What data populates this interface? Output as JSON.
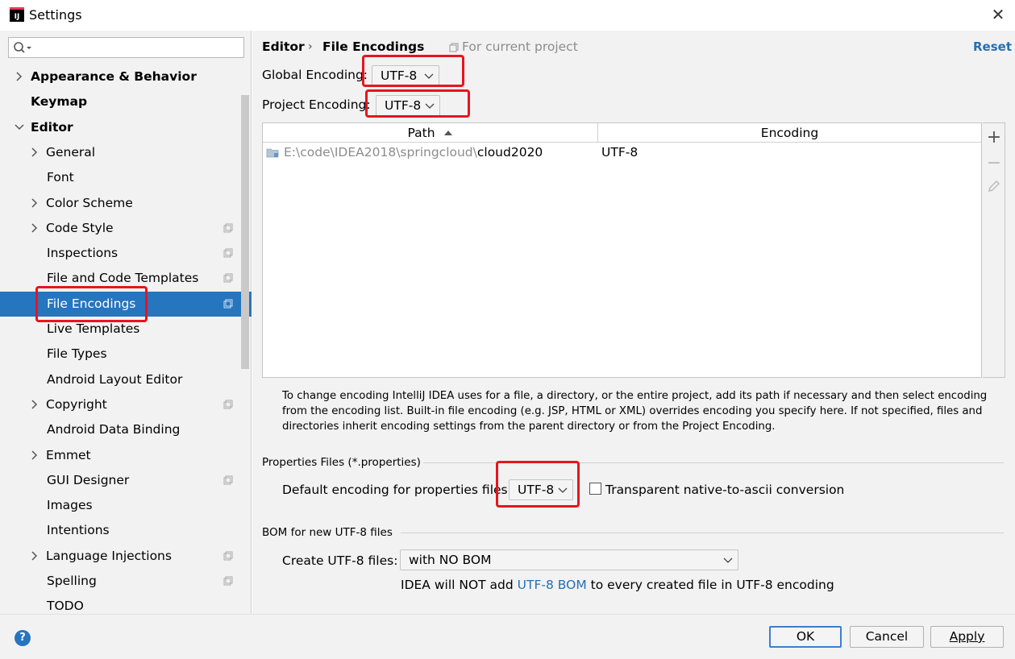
{
  "window": {
    "title": "Settings"
  },
  "search": {
    "placeholder": ""
  },
  "sidebar": {
    "items": [
      {
        "label": "Appearance & Behavior",
        "bold": true,
        "level": 0,
        "chevron": "right"
      },
      {
        "label": "Keymap",
        "bold": true,
        "level": 0,
        "chevron": ""
      },
      {
        "label": "Editor",
        "bold": true,
        "level": 0,
        "chevron": "down"
      },
      {
        "label": "General",
        "level": 1,
        "chevron": "right"
      },
      {
        "label": "Font",
        "level": 1,
        "chevron": ""
      },
      {
        "label": "Color Scheme",
        "level": 1,
        "chevron": "right"
      },
      {
        "label": "Code Style",
        "level": 1,
        "chevron": "right",
        "scope_icon": true
      },
      {
        "label": "Inspections",
        "level": 1,
        "chevron": "",
        "scope_icon": true
      },
      {
        "label": "File and Code Templates",
        "level": 1,
        "chevron": "",
        "scope_icon": true
      },
      {
        "label": "File Encodings",
        "level": 1,
        "chevron": "",
        "scope_icon": true,
        "selected": true
      },
      {
        "label": "Live Templates",
        "level": 1,
        "chevron": ""
      },
      {
        "label": "File Types",
        "level": 1,
        "chevron": ""
      },
      {
        "label": "Android Layout Editor",
        "level": 1,
        "chevron": ""
      },
      {
        "label": "Copyright",
        "level": 1,
        "chevron": "right",
        "scope_icon": true
      },
      {
        "label": "Android Data Binding",
        "level": 1,
        "chevron": ""
      },
      {
        "label": "Emmet",
        "level": 1,
        "chevron": "right"
      },
      {
        "label": "GUI Designer",
        "level": 1,
        "chevron": "",
        "scope_icon": true
      },
      {
        "label": "Images",
        "level": 1,
        "chevron": ""
      },
      {
        "label": "Intentions",
        "level": 1,
        "chevron": ""
      },
      {
        "label": "Language Injections",
        "level": 1,
        "chevron": "right",
        "scope_icon": true
      },
      {
        "label": "Spelling",
        "level": 1,
        "chevron": "",
        "scope_icon": true
      },
      {
        "label": "TODO",
        "level": 1,
        "chevron": ""
      }
    ]
  },
  "header": {
    "crumb_parent": "Editor",
    "crumb_current": "File Encodings",
    "scope_note": "For current project",
    "reset_label": "Reset"
  },
  "encoding": {
    "global_label": "Global Encoding:",
    "global_value": "UTF-8",
    "project_label": "Project Encoding:",
    "project_value": "UTF-8"
  },
  "table": {
    "columns": [
      "Path",
      "Encoding"
    ],
    "rows": [
      {
        "path_prefix": "E:\\code\\IDEA2018\\springcloud\\",
        "path_name": "cloud2020",
        "encoding": "UTF-8"
      }
    ]
  },
  "tools": {
    "add": "+",
    "remove": "−"
  },
  "info_text": "To change encoding IntelliJ IDEA uses for a file, a directory, or the entire project, add its path if necessary and then select encoding from the encoding list. Built-in file encoding (e.g. JSP, HTML or XML) overrides encoding you specify here. If not specified, files and directories inherit encoding settings from the parent directory or from the Project Encoding.",
  "properties": {
    "section_title": "Properties Files (*.properties)",
    "default_label": "Default encoding for properties files",
    "default_value": "UTF-8",
    "transparent_label": "Transparent native-to-ascii conversion",
    "transparent_checked": false
  },
  "bom": {
    "section_title": "BOM for new UTF-8 files",
    "create_label": "Create UTF-8 files:",
    "create_value": "with NO BOM",
    "note_before": "IDEA will NOT add ",
    "note_link": "UTF-8 BOM",
    "note_after": " to every created file in UTF-8 encoding"
  },
  "footer": {
    "help": "?",
    "ok": "OK",
    "cancel": "Cancel",
    "apply": "Apply"
  },
  "colors": {
    "selection": "#2675bf",
    "link": "#2470b3",
    "highlight_box": "#e8141e"
  }
}
